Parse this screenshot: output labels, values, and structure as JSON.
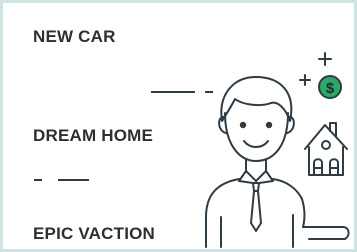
{
  "labels": {
    "item1": "NEW CAR",
    "item2": "DREAM HOME",
    "item3": "EPIC VACTION"
  },
  "icons": {
    "person": "businessman-icon",
    "house": "house-icon",
    "coin": "dollar-coin-icon",
    "coin_symbol": "$",
    "sparkle": "plus-icon"
  },
  "colors": {
    "border": "#cfe3e3",
    "text": "#2f2f2f",
    "line": "#2f3b45",
    "accent": "#2ea86a"
  }
}
